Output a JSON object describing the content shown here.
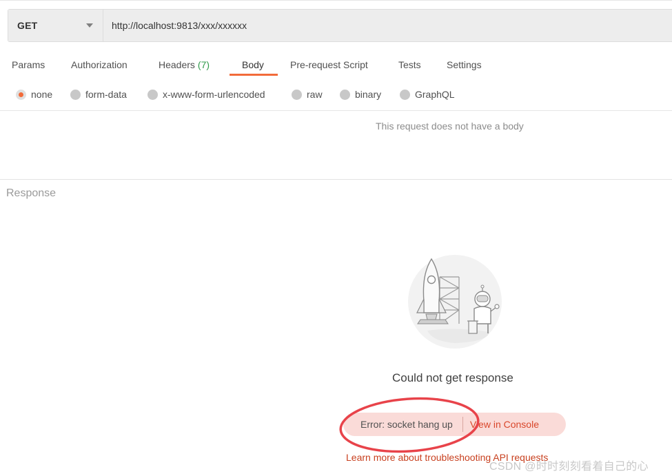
{
  "request": {
    "method": "GET",
    "url": "http://localhost:9813/xxx/xxxxxx"
  },
  "tabs": [
    {
      "label": "Params"
    },
    {
      "label": "Authorization"
    },
    {
      "label": "Headers",
      "count": "(7)"
    },
    {
      "label": "Body",
      "active": true
    },
    {
      "label": "Pre-request Script"
    },
    {
      "label": "Tests"
    },
    {
      "label": "Settings"
    }
  ],
  "body_types": [
    {
      "label": "none",
      "selected": true
    },
    {
      "label": "form-data"
    },
    {
      "label": "x-www-form-urlencoded"
    },
    {
      "label": "raw"
    },
    {
      "label": "binary"
    },
    {
      "label": "GraphQL"
    }
  ],
  "body_empty_text": "This request does not have a body",
  "response": {
    "label": "Response",
    "error_title": "Could not get response",
    "error_message": "Error: socket hang up",
    "view_console": "View in Console",
    "learn_more": "Learn more about troubleshooting API requests"
  },
  "watermark": "CSDN @时时刻刻看着自己的心",
  "colors": {
    "accent": "#f26b3a",
    "headers_count": "#2f9b4a",
    "error_pill": "#fadbd8",
    "link": "#c8401f",
    "annotation": "#e8434a"
  }
}
